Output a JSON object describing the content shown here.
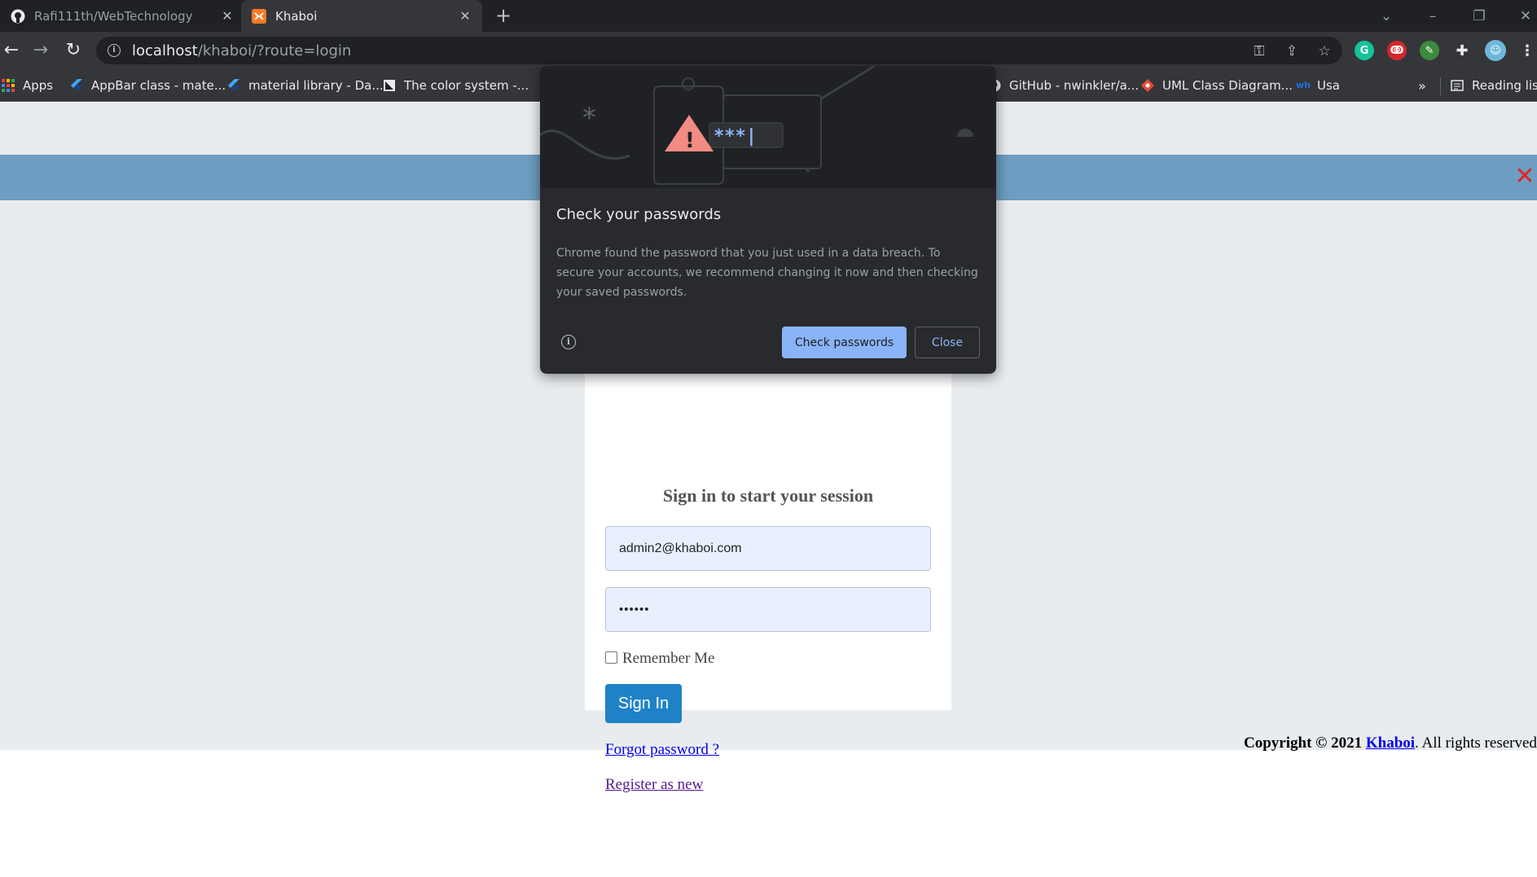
{
  "browser": {
    "tabs": [
      {
        "title": "Rafi111th/WebTechnology",
        "icon": "github-icon",
        "active": false
      },
      {
        "title": "Khaboi",
        "icon": "xampp-icon",
        "active": true
      }
    ],
    "url": {
      "host": "localhost",
      "path": "/khaboi/?route=login"
    },
    "bookmarks": [
      {
        "label": "Apps",
        "icon": "apps-grid-icon"
      },
      {
        "label": "AppBar class - mate...",
        "icon": "flutter-icon"
      },
      {
        "label": "material library - Da...",
        "icon": "flutter-icon"
      },
      {
        "label": "The color system -...",
        "icon": "material-icon"
      },
      {
        "label": "GitHub - nwinkler/a...",
        "icon": "github-icon"
      },
      {
        "label": "UML Class Diagram...",
        "icon": "diamond-icon"
      },
      {
        "label": "Usa",
        "icon": "wh-icon"
      },
      {
        "label": "Reading list",
        "icon": "reading-list-icon"
      }
    ],
    "overflow_chevron": "»"
  },
  "bubble": {
    "title": "Check your passwords",
    "body": "Chrome found the password that you just used in a data breach. To secure your accounts, we recommend changing it now and then checking your saved passwords.",
    "primary_label": "Check passwords",
    "secondary_label": "Close",
    "art_password_mask": "***|"
  },
  "login": {
    "message": "Sign in to start your session",
    "email_value": "admin2@khaboi.com",
    "password_value": "••••••",
    "remember_label": "Remember Me",
    "remember_checked": false,
    "signin_label": "Sign In",
    "forgot_label": "Forgot password ?",
    "register_label": "Register as new"
  },
  "footer": {
    "prefix": "Copyright © 2021 ",
    "brand": "Khaboi",
    "suffix": ". All rights reserved."
  },
  "colors": {
    "banner": "#6d9dc1",
    "page_bg": "#e9ecef",
    "signin": "#1f82c7",
    "bubble_primary": "#8ab4f8",
    "close_x": "#e02424"
  }
}
